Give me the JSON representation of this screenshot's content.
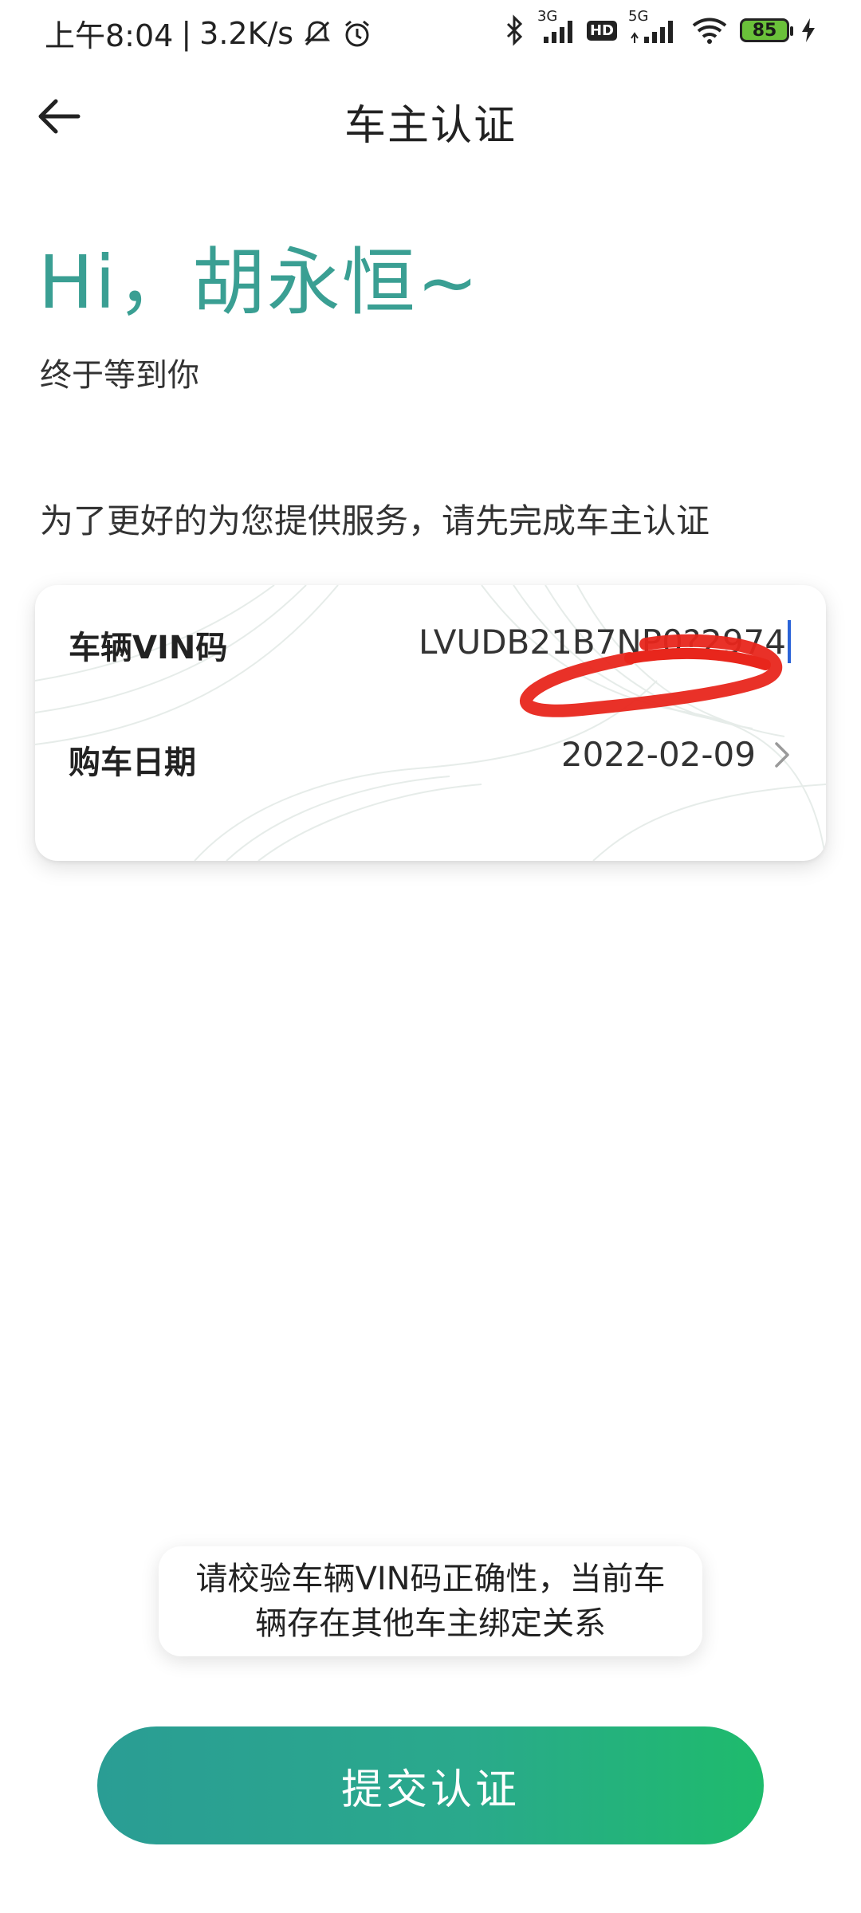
{
  "status_bar": {
    "time": "上午8:04",
    "net_speed": "3.2K/s",
    "sig1_label": "3G",
    "hd_label": "HD",
    "sig2_label": "5G",
    "battery": "85"
  },
  "nav": {
    "title": "车主认证"
  },
  "greeting": {
    "title": "Hi，胡永恒~",
    "subtitle": "终于等到你"
  },
  "intro": "为了更好的为您提供服务，请先完成车主认证",
  "form": {
    "vin_label": "车辆VIN码",
    "vin_value": "LVUDB21B7NP0?2974",
    "date_label": "购车日期",
    "date_value": "2022-02-09"
  },
  "toast": {
    "message": "请校验车辆VIN码正确性，当前车辆存在其他车主绑定关系"
  },
  "submit": {
    "label": "提交认证"
  },
  "colors": {
    "accent": "#3a9f93",
    "button_start": "#2a9d94",
    "button_end": "#1ebb6c",
    "annotation": "#e8261c"
  }
}
